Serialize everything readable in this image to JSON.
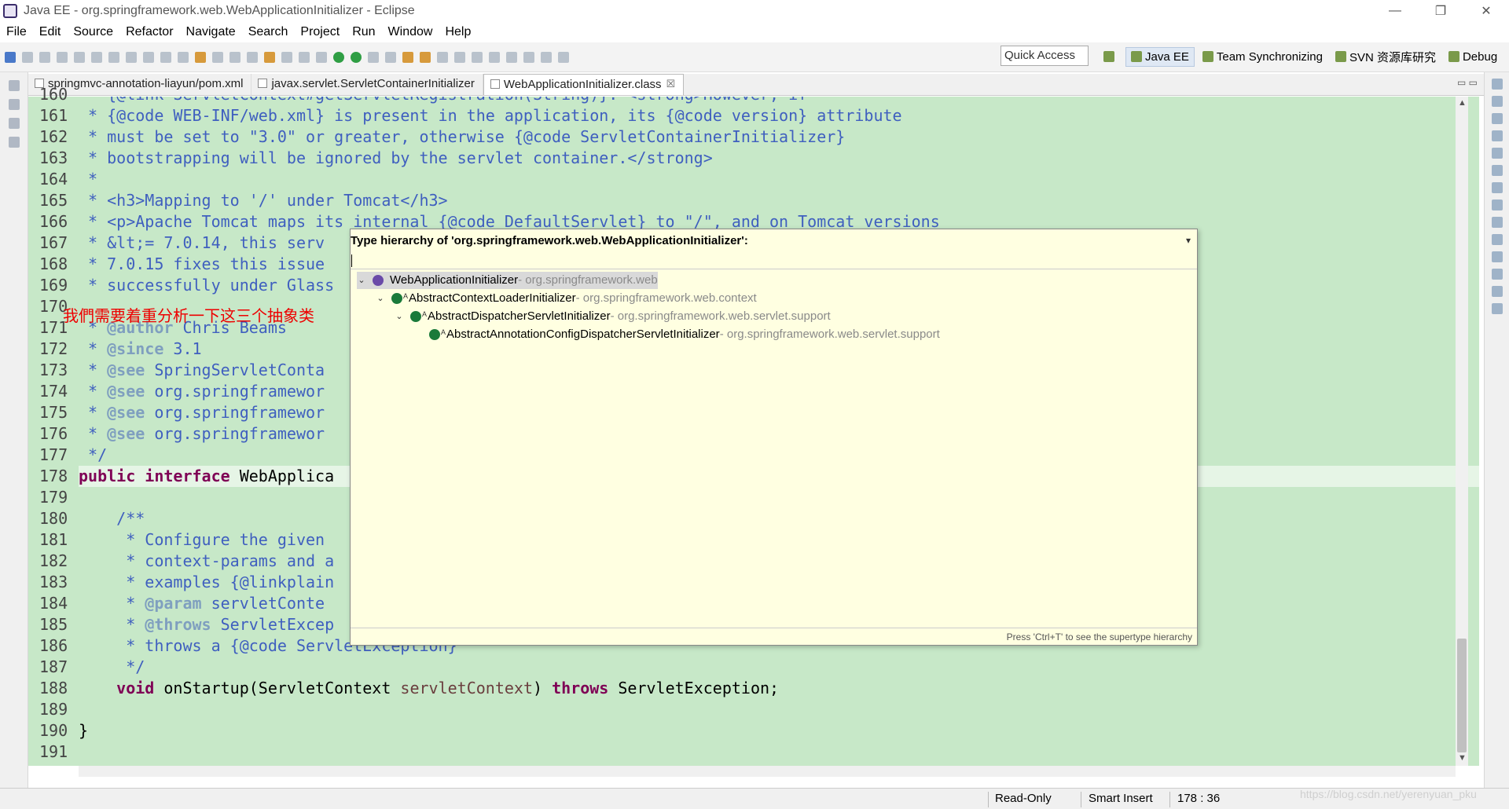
{
  "window": {
    "title": "Java EE - org.springframework.web.WebApplicationInitializer - Eclipse",
    "controls": [
      "—",
      "❐",
      "✕"
    ]
  },
  "menu": [
    "File",
    "Edit",
    "Source",
    "Refactor",
    "Navigate",
    "Search",
    "Project",
    "Run",
    "Window",
    "Help"
  ],
  "toolbar": {
    "quick_access": "Quick Access",
    "perspectives": [
      "Java EE",
      "Team Synchronizing",
      "SVN 资源库研究",
      "Debug"
    ]
  },
  "tabs": [
    {
      "label": "springmvc-annotation-liayun/pom.xml",
      "active": false
    },
    {
      "label": "javax.servlet.ServletContainerInitializer",
      "active": false
    },
    {
      "label": "WebApplicationInitializer.class",
      "active": true,
      "close": "☒"
    }
  ],
  "editor": {
    "line_numbers": [
      "160",
      "161",
      "162",
      "163",
      "164",
      "165",
      "166",
      "167",
      "168",
      "169",
      "170",
      "171",
      "172",
      "173",
      "174",
      "175",
      "176",
      "177",
      "178",
      "179",
      "180",
      "181",
      "182",
      "183",
      "184",
      "185",
      "186",
      "187",
      "188",
      "189",
      "190",
      "191"
    ],
    "code": {
      "l160": " * {@link ServletContext#getServletRegistration(String)}. <strong>However, if",
      "l161": " * {@code WEB-INF/web.xml} is present in the application, its {@code version} attribute",
      "l162": " * must be set to \"3.0\" or greater, otherwise {@code ServletContainerInitializer}",
      "l163": " * bootstrapping will be ignored by the servlet container.</strong>",
      "l164": " *",
      "l165": " * <h3>Mapping to '/' under Tomcat</h3>",
      "l166": " * <p>Apache Tomcat maps its internal {@code DefaultServlet} to \"/\", and on Tomcat versions",
      "l167": " * &lt;= 7.0.14, this serv",
      "l168": " * 7.0.15 fixes this issue",
      "l169": " * successfully under Glass",
      "l170": " ",
      "l171_kw": "@author",
      "l171": " Chris Beams",
      "l172_kw": "@since",
      "l172": " 3.1",
      "l173_kw": "@see",
      "l173": " SpringServletConta",
      "l174_kw": "@see",
      "l174": " org.springframewor",
      "l175_kw": "@see",
      "l175": " org.springframewor",
      "l176_kw": "@see",
      "l176": " org.springframewor",
      "l177": " */",
      "l178_kw1": "public",
      "l178_kw2": "interface",
      "l178": " WebApplica",
      "l180": "    /**",
      "l181": "     * Configure the given",
      "l182": "     * context-params and a",
      "l183": "     * examples {@linkplain",
      "l184_kw": "@param",
      "l184": " servletConte",
      "l185_kw": "@throws",
      "l185": " ServletExcep",
      "l186": "     * throws a {@code ServletException}",
      "l187": "     */",
      "l188_kw1": "void",
      "l188_a": " onStartup(ServletContext ",
      "l188_par": "servletContext",
      "l188_b": ") ",
      "l188_kw2": "throws",
      "l188_c": " ServletException;",
      "l190": "}"
    },
    "annotation_text": "我們需要着重分析一下这三个抽象类"
  },
  "type_hierarchy_popup": {
    "title": "Type hierarchy of 'org.springframework.web.WebApplicationInitializer':",
    "menu_icon": "▾",
    "nodes": [
      {
        "name": "WebApplicationInitializer",
        "pkg": " - org.springframework.web",
        "kind": "interface",
        "icon": "interface-icon",
        "twisty": "⌄"
      },
      {
        "name": "AbstractContextLoaderInitializer",
        "pkg": " - org.springframework.web.context",
        "kind": "abstract-class",
        "icon": "abstract-class-icon",
        "twisty": "⌄"
      },
      {
        "name": "AbstractDispatcherServletInitializer",
        "pkg": " - org.springframework.web.servlet.support",
        "kind": "abstract-class",
        "icon": "abstract-class-icon",
        "twisty": "⌄"
      },
      {
        "name": "AbstractAnnotationConfigDispatcherServletInitializer",
        "pkg": " - org.springframework.web.servlet.support",
        "kind": "abstract-class",
        "icon": "abstract-class-icon",
        "twisty": ""
      }
    ],
    "footer": "Press 'Ctrl+T' to see the supertype hierarchy"
  },
  "status": {
    "mode": "Read-Only",
    "insert": "Smart Insert",
    "position": "178 : 36",
    "watermark": "https://blog.csdn.net/yerenyuan_pku"
  },
  "colors": {
    "editor_bg": "#c7e8c8",
    "keyword": "#7f0055",
    "javadoc": "#3f5fbf",
    "annotation": "#e00000",
    "popup_bg": "#ffffe1"
  }
}
